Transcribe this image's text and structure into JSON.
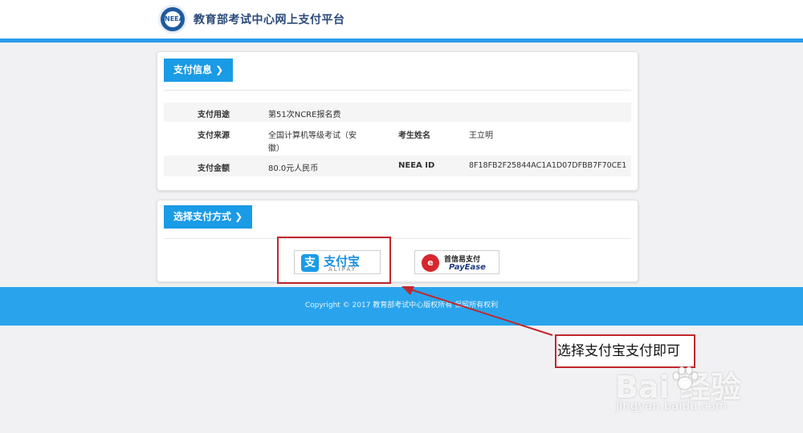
{
  "header": {
    "logo_text": "NEEA",
    "site_title": "教育部考试中心网上支付平台"
  },
  "payment_info": {
    "section_title": "支付信息 ❯",
    "purpose_label": "支付用途",
    "purpose_value": "第51次NCRE报名费",
    "source_label": "支付来源",
    "source_value_line1": "全国计算机等级考试（安",
    "source_value_line2": "徽）",
    "candidate_label": "考生姓名",
    "candidate_value": "王立明",
    "amount_label": "支付金额",
    "amount_value": "80.0元人民币",
    "neea_label": "NEEA ID",
    "neea_value": "8F18FB2F25844AC1A1D07DFBB7F70CE1"
  },
  "payment_method": {
    "section_title": "选择支付方式 ❯",
    "alipay_mark": "支",
    "alipay_name": "支付宝",
    "alipay_sub": "ALIPAY",
    "payease_mark": "e",
    "payease_name": "首信易支付",
    "payease_sub": "PayEase"
  },
  "footer": {
    "copyright": "Copyright © 2017 教育部考试中心版权所有 保留所有权利"
  },
  "annotation": {
    "callout_text": "选择支付宝支付即可",
    "accent_color": "#c1272d"
  },
  "watermark": {
    "brand": "Bai  经验",
    "url": "jingyan.baidu.com"
  }
}
